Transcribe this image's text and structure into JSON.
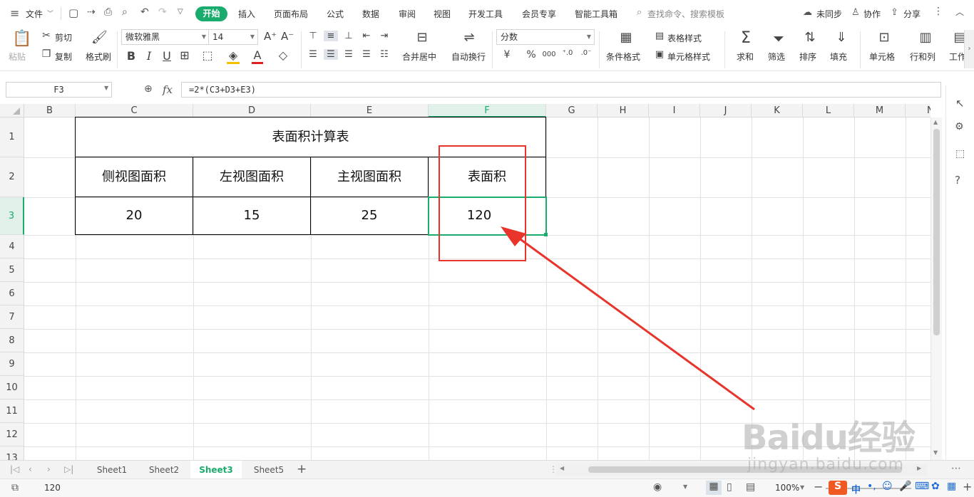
{
  "menubar": {
    "file_label": "文件",
    "tabs": [
      "开始",
      "插入",
      "页面布局",
      "公式",
      "数据",
      "审阅",
      "视图",
      "开发工具",
      "会员专享",
      "智能工具箱"
    ],
    "search_placeholder": "查找命令、搜索模板",
    "sync_label": "未同步",
    "collab_label": "协作",
    "share_label": "分享"
  },
  "ribbon": {
    "paste_label": "粘贴",
    "cut_label": "剪切",
    "copy_label": "复制",
    "format_painter_label": "格式刷",
    "font_name": "微软雅黑",
    "font_size": "14",
    "merge_center_label": "合并居中",
    "wrap_text_label": "自动换行",
    "number_format": "分数",
    "conditional_format_label": "条件格式",
    "table_style_label": "表格样式",
    "cell_style_label": "单元格样式",
    "sum_label": "求和",
    "filter_label": "筛选",
    "sort_label": "排序",
    "fill_label": "填充",
    "cell_label": "单元格",
    "row_col_label": "行和列",
    "worksheet_label": "工作"
  },
  "formula_bar": {
    "name_box": "F3",
    "fx": "fx",
    "formula": "=2*(C3+D3+E3)"
  },
  "sheet": {
    "columns": [
      "B",
      "C",
      "D",
      "E",
      "F",
      "G",
      "H",
      "I",
      "J",
      "K",
      "L",
      "M",
      "N"
    ],
    "selected_column": "F",
    "rows": [
      "1",
      "2",
      "3",
      "4",
      "5",
      "6",
      "7",
      "8",
      "9",
      "10",
      "11",
      "12",
      "13"
    ],
    "selected_row": "3",
    "title": "表面积计算表",
    "headers": [
      "侧视图面积",
      "左视图面积",
      "主视图面积",
      "表面积"
    ],
    "values": [
      "20",
      "15",
      "25",
      "120"
    ]
  },
  "sheet_tabs": [
    "Sheet1",
    "Sheet2",
    "Sheet3",
    "Sheet5"
  ],
  "active_sheet": "Sheet3",
  "status": {
    "value": "120",
    "zoom": "100%"
  },
  "watermark": {
    "brand": "Baidu经验",
    "url": "jingyan.baidu.com"
  },
  "colors": {
    "accent": "#1aac6c",
    "annotation": "#e8342a"
  }
}
